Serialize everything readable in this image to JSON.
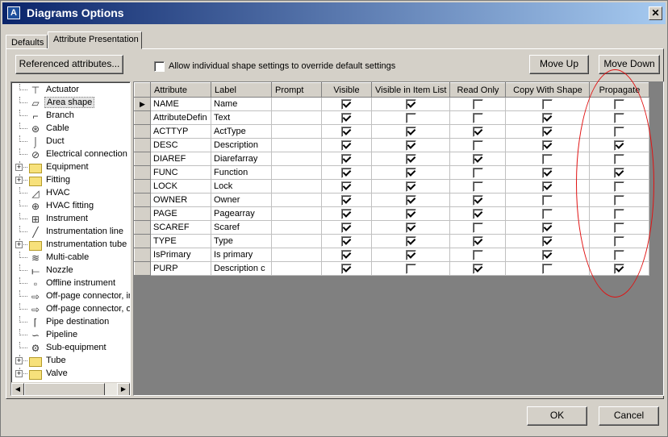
{
  "window": {
    "title": "Diagrams Options",
    "app_icon_letter": "A"
  },
  "tabs": [
    {
      "label": "Defaults",
      "active": false
    },
    {
      "label": "Attribute Presentation",
      "active": true
    }
  ],
  "buttons": {
    "referenced_attributes": "Referenced attributes...",
    "move_up": "Move Up",
    "move_down": "Move Down",
    "ok": "OK",
    "cancel": "Cancel"
  },
  "allow_override": {
    "label": "Allow individual shape settings to override default settings",
    "checked": false
  },
  "tree": {
    "items": [
      {
        "label": "Actuator",
        "icon": "actuator-icon",
        "expandable": false
      },
      {
        "label": "Area shape",
        "icon": "area-shape-icon",
        "expandable": false,
        "selected": true
      },
      {
        "label": "Branch",
        "icon": "branch-icon",
        "expandable": false
      },
      {
        "label": "Cable",
        "icon": "cable-icon",
        "expandable": false
      },
      {
        "label": "Duct",
        "icon": "duct-icon",
        "expandable": false
      },
      {
        "label": "Electrical connection",
        "icon": "electrical-connection-icon",
        "expandable": false
      },
      {
        "label": "Equipment",
        "icon": "folder-icon",
        "expandable": true
      },
      {
        "label": "Fitting",
        "icon": "folder-icon",
        "expandable": true
      },
      {
        "label": "HVAC",
        "icon": "hvac-icon",
        "expandable": false
      },
      {
        "label": "HVAC fitting",
        "icon": "hvac-fitting-icon",
        "expandable": false
      },
      {
        "label": "Instrument",
        "icon": "instrument-icon",
        "expandable": false
      },
      {
        "label": "Instrumentation line",
        "icon": "instrumentation-line-icon",
        "expandable": false
      },
      {
        "label": "Instrumentation tube",
        "icon": "folder-icon",
        "expandable": true
      },
      {
        "label": "Multi-cable",
        "icon": "multi-cable-icon",
        "expandable": false
      },
      {
        "label": "Nozzle",
        "icon": "nozzle-icon",
        "expandable": false
      },
      {
        "label": "Offline instrument",
        "icon": "offline-instrument-icon",
        "expandable": false
      },
      {
        "label": "Off-page connector, ir",
        "icon": "off-page-connector-icon",
        "expandable": false
      },
      {
        "label": "Off-page connector, o",
        "icon": "off-page-connector-icon",
        "expandable": false
      },
      {
        "label": "Pipe destination",
        "icon": "pipe-destination-icon",
        "expandable": false
      },
      {
        "label": "Pipeline",
        "icon": "pipeline-icon",
        "expandable": false
      },
      {
        "label": "Sub-equipment",
        "icon": "sub-equipment-icon",
        "expandable": false
      },
      {
        "label": "Tube",
        "icon": "folder-icon",
        "expandable": true
      },
      {
        "label": "Valve",
        "icon": "folder-icon",
        "expandable": true
      }
    ]
  },
  "grid": {
    "columns": [
      "Attribute",
      "Label",
      "Prompt",
      "Visible",
      "Visible in Item List",
      "Read Only",
      "Copy With Shape",
      "Propagate"
    ],
    "rows": [
      {
        "attribute": "NAME",
        "label": "Name",
        "prompt": "",
        "visible": true,
        "visible_in_item_list": true,
        "read_only": false,
        "copy_with_shape": false,
        "propagate": false,
        "current": true
      },
      {
        "attribute": "AttributeDefin",
        "label": "Text",
        "prompt": "",
        "visible": true,
        "visible_in_item_list": false,
        "read_only": false,
        "copy_with_shape": true,
        "propagate": false
      },
      {
        "attribute": "ACTTYP",
        "label": "ActType",
        "prompt": "",
        "visible": true,
        "visible_in_item_list": true,
        "read_only": true,
        "copy_with_shape": true,
        "propagate": false
      },
      {
        "attribute": "DESC",
        "label": "Description",
        "prompt": "",
        "visible": true,
        "visible_in_item_list": true,
        "read_only": false,
        "copy_with_shape": true,
        "propagate": true
      },
      {
        "attribute": "DIAREF",
        "label": "Diarefarray",
        "prompt": "",
        "visible": true,
        "visible_in_item_list": true,
        "read_only": true,
        "copy_with_shape": false,
        "propagate": false
      },
      {
        "attribute": "FUNC",
        "label": "Function",
        "prompt": "",
        "visible": true,
        "visible_in_item_list": true,
        "read_only": false,
        "copy_with_shape": true,
        "propagate": true
      },
      {
        "attribute": "LOCK",
        "label": "Lock",
        "prompt": "",
        "visible": true,
        "visible_in_item_list": true,
        "read_only": false,
        "copy_with_shape": true,
        "propagate": false
      },
      {
        "attribute": "OWNER",
        "label": "Owner",
        "prompt": "",
        "visible": true,
        "visible_in_item_list": true,
        "read_only": true,
        "copy_with_shape": false,
        "propagate": false
      },
      {
        "attribute": "PAGE",
        "label": "Pagearray",
        "prompt": "",
        "visible": true,
        "visible_in_item_list": true,
        "read_only": true,
        "copy_with_shape": false,
        "propagate": false
      },
      {
        "attribute": "SCAREF",
        "label": "Scaref",
        "prompt": "",
        "visible": true,
        "visible_in_item_list": true,
        "read_only": false,
        "copy_with_shape": true,
        "propagate": false
      },
      {
        "attribute": "TYPE",
        "label": "Type",
        "prompt": "",
        "visible": true,
        "visible_in_item_list": true,
        "read_only": true,
        "copy_with_shape": true,
        "propagate": false
      },
      {
        "attribute": "IsPrimary",
        "label": "Is primary",
        "prompt": "",
        "visible": true,
        "visible_in_item_list": true,
        "read_only": false,
        "copy_with_shape": true,
        "propagate": false
      },
      {
        "attribute": "PURP",
        "label": "Description c",
        "prompt": "",
        "visible": true,
        "visible_in_item_list": false,
        "read_only": true,
        "copy_with_shape": false,
        "propagate": true
      }
    ]
  },
  "annotation": {
    "color": "#e11111",
    "shape": "ellipse-around-propagate-column"
  }
}
